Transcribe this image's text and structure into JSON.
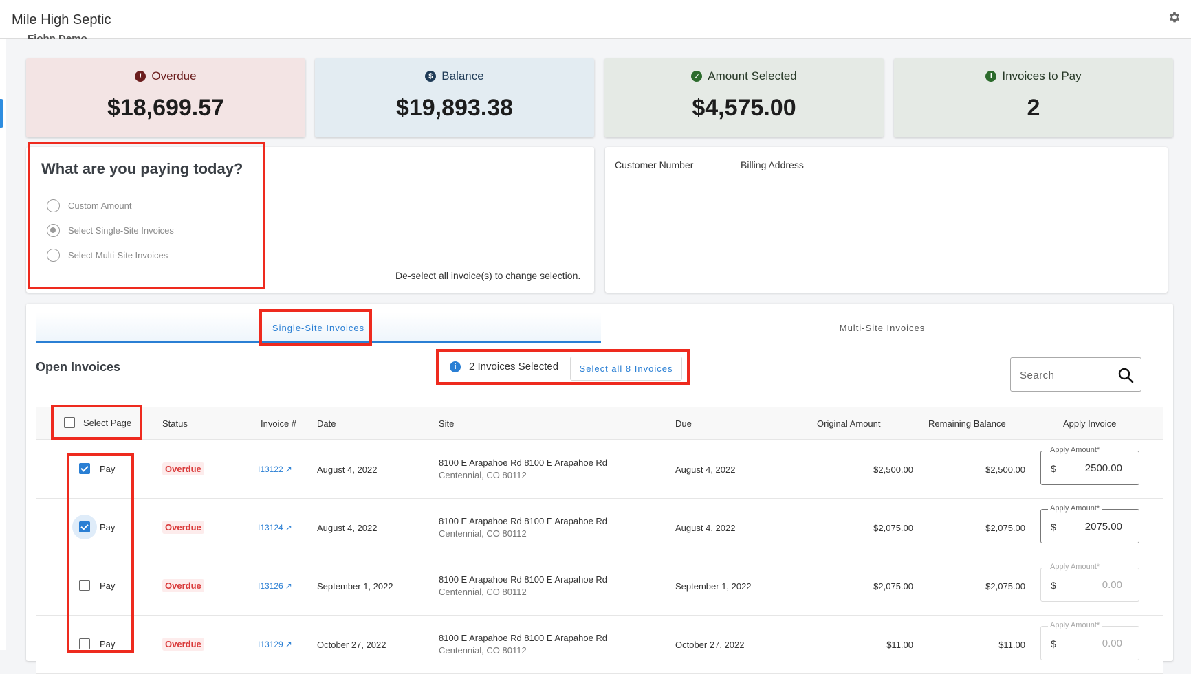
{
  "app": {
    "title": "Mile High Septic",
    "settings_icon": "gear-icon",
    "customer_name_partial": "Fjohn Demo"
  },
  "summary": {
    "overdue": {
      "label": "Overdue",
      "value": "$18,699.57",
      "color": "#f3e4e4",
      "icon": "alert-icon"
    },
    "balance": {
      "label": "Balance",
      "value": "$19,893.38",
      "color": "#e3ecf2",
      "icon": "dollar-icon"
    },
    "amount_selected": {
      "label": "Amount Selected",
      "value": "$4,575.00",
      "color": "#e5eae5",
      "icon": "check-circle-icon"
    },
    "invoices_to_pay": {
      "label": "Invoices to Pay",
      "value": "2",
      "color": "#e5eae5",
      "icon": "info-icon"
    }
  },
  "payment_type": {
    "title": "What are you paying today?",
    "options": [
      "Custom Amount",
      "Select Single-Site Invoices",
      "Select Multi-Site Invoices"
    ],
    "selected": "Select Single-Site Invoices",
    "note": "De-select all invoice(s) to change selection."
  },
  "customer": {
    "number_label": "Customer Number",
    "address_label": "Billing Address"
  },
  "tabs": [
    {
      "label": "Single-Site Invoices",
      "active": true
    },
    {
      "label": "Multi-Site Invoices",
      "active": false
    }
  ],
  "invoices": {
    "title": "Open Invoices",
    "selected_text": "2 Invoices Selected",
    "select_all_label": "Select all 8 Invoices",
    "search_placeholder": "Search",
    "columns": [
      "Select Page",
      "Status",
      "Invoice #",
      "Date",
      "Site",
      "Due",
      "Original Amount",
      "Remaining Balance",
      "Apply Invoice"
    ],
    "apply_legend": "Apply Amount*",
    "currency": "$",
    "rows": [
      {
        "checked": true,
        "pay": "Pay",
        "status": "Overdue",
        "invoice": "I13122",
        "date": "August 4, 2022",
        "site_line1": "8100 E Arapahoe Rd 8100 E Arapahoe Rd",
        "site_line2": "Centennial, CO 80112",
        "due": "August 4, 2022",
        "original": "$2,500.00",
        "remaining": "$2,500.00",
        "apply": "2500.00"
      },
      {
        "checked": true,
        "pay": "Pay",
        "status": "Overdue",
        "invoice": "I13124",
        "date": "August 4, 2022",
        "site_line1": "8100 E Arapahoe Rd 8100 E Arapahoe Rd",
        "site_line2": "Centennial, CO 80112",
        "due": "August 4, 2022",
        "original": "$2,075.00",
        "remaining": "$2,075.00",
        "apply": "2075.00"
      },
      {
        "checked": false,
        "pay": "Pay",
        "status": "Overdue",
        "invoice": "I13126",
        "date": "September 1, 2022",
        "site_line1": "8100 E Arapahoe Rd 8100 E Arapahoe Rd",
        "site_line2": "Centennial, CO 80112",
        "due": "September 1, 2022",
        "original": "$2,075.00",
        "remaining": "$2,075.00",
        "apply": "0.00"
      },
      {
        "checked": false,
        "pay": "Pay",
        "status": "Overdue",
        "invoice": "I13129",
        "date": "October 27, 2022",
        "site_line1": "8100 E Arapahoe Rd 8100 E Arapahoe Rd",
        "site_line2": "Centennial, CO 80112",
        "due": "October 27, 2022",
        "original": "$11.00",
        "remaining": "$11.00",
        "apply": "0.00"
      }
    ]
  },
  "highlight_color": "#ee2a1e"
}
